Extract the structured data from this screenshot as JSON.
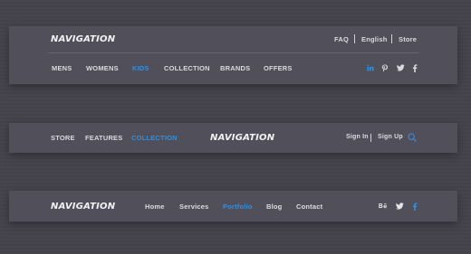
{
  "bar1": {
    "logo": "NAVIGATION",
    "top_links": [
      "FAQ",
      "English",
      "Store"
    ],
    "menu": [
      "MENS",
      "WOMENS",
      "KIDS",
      "COLLECTION",
      "BRANDS",
      "OFFERS"
    ],
    "active_menu": "KIDS",
    "social_icons": [
      "linkedin-icon",
      "pinterest-icon",
      "twitter-icon",
      "facebook-icon"
    ]
  },
  "bar2": {
    "menu": [
      "STORE",
      "FEATURES",
      "COLLECTION"
    ],
    "active_menu": "COLLECTION",
    "logo": "NAVIGATION",
    "sign_in": "Sign In",
    "sign_up": "Sign Up",
    "search_icon": "search-icon"
  },
  "bar3": {
    "logo": "NAVIGATION",
    "menu": [
      "Home",
      "Services",
      "Portfolio",
      "Blog",
      "Contact"
    ],
    "active_menu": "Portfolio",
    "social_icons": [
      "behance-icon",
      "twitter-icon",
      "facebook-icon"
    ]
  },
  "colors": {
    "background": "#45444d",
    "bar": "#51505a",
    "accent": "#2f8fe0",
    "text": "#d9d9df"
  }
}
